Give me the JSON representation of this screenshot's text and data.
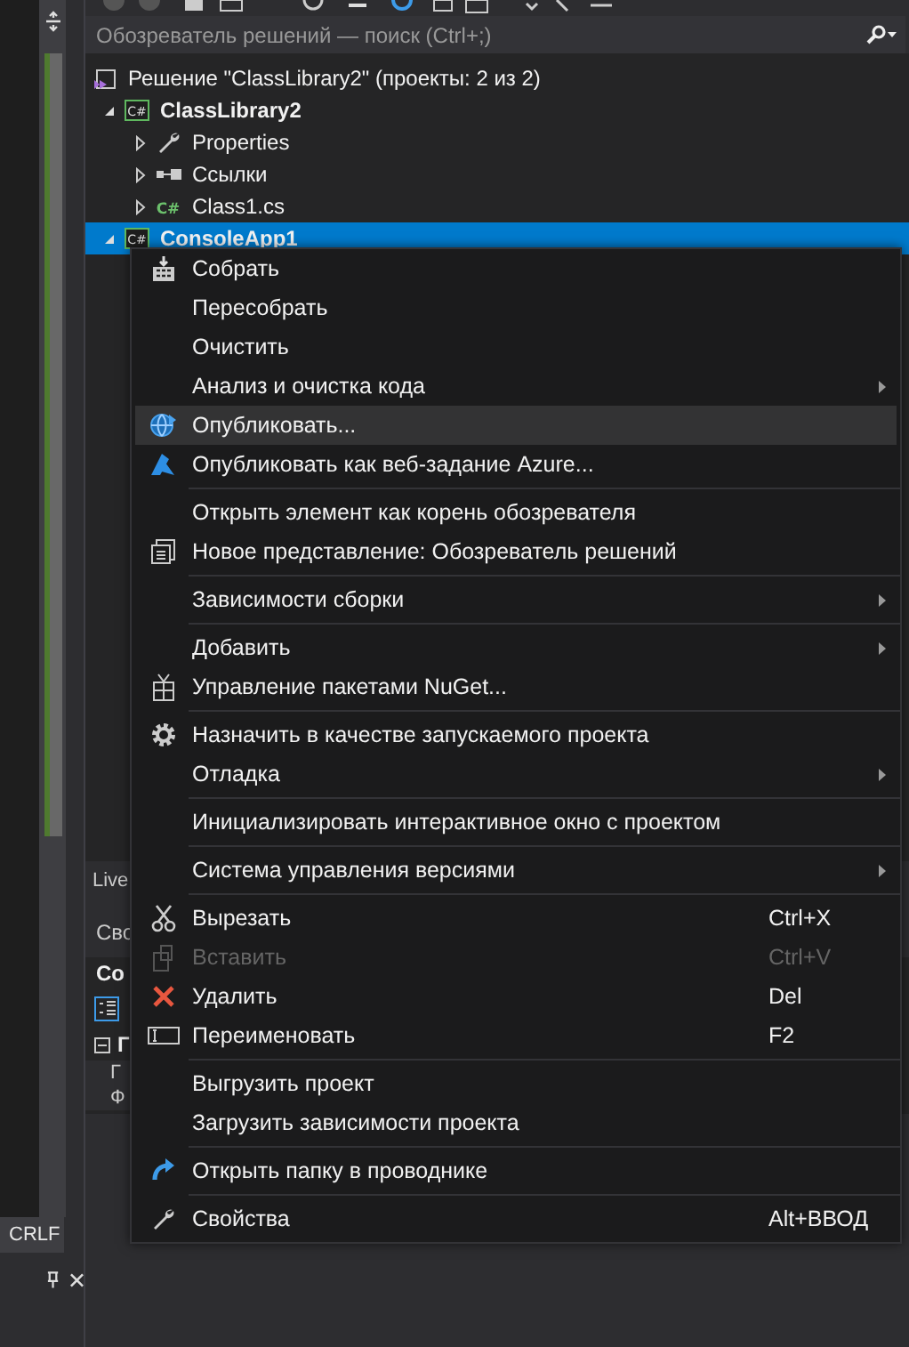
{
  "editor": {
    "status": "CRLF"
  },
  "explorer": {
    "search": {
      "placeholder": "Обозреватель решений — поиск (Ctrl+;)"
    },
    "tree": [
      {
        "kind": "solution",
        "label": "Решение \"ClassLibrary2\" (проекты: 2 из 2)",
        "bold": false,
        "selected": false,
        "children": [
          {
            "kind": "project",
            "badge": "C#",
            "label": "ClassLibrary2",
            "bold": true,
            "expanded": true,
            "selected": false,
            "children": [
              {
                "kind": "properties",
                "label": "Properties",
                "bold": false,
                "expanded": false,
                "selected": false
              },
              {
                "kind": "references",
                "label": "Ссылки",
                "bold": false,
                "expanded": false,
                "selected": false
              },
              {
                "kind": "file",
                "badge": "C#",
                "label": "Class1.cs",
                "bold": false,
                "expanded": false,
                "selected": false
              }
            ]
          },
          {
            "kind": "project",
            "badge": "C#",
            "label": "ConsoleApp1",
            "bold": true,
            "expanded": true,
            "selected": true
          }
        ]
      }
    ],
    "live_tab": "Live",
    "properties": {
      "title": "Сво",
      "object": "Co",
      "group": "Г",
      "rows": [
        "Г",
        "Ф"
      ]
    }
  },
  "context_menu": [
    {
      "kind": "item",
      "label": "Собрать",
      "submenu": false,
      "disabled": false,
      "selected": false
    },
    {
      "kind": "item",
      "label": "Пересобрать",
      "submenu": false,
      "disabled": false,
      "selected": false
    },
    {
      "kind": "item",
      "label": "Очистить",
      "submenu": false,
      "disabled": false,
      "selected": false
    },
    {
      "kind": "item",
      "label": "Анализ и очистка кода",
      "submenu": true,
      "disabled": false,
      "selected": false
    },
    {
      "kind": "item",
      "label": "Опубликовать...",
      "submenu": false,
      "disabled": false,
      "selected": true
    },
    {
      "kind": "item",
      "label": "Опубликовать как веб-задание Azure...",
      "submenu": false,
      "disabled": false,
      "selected": false
    },
    {
      "kind": "separator"
    },
    {
      "kind": "item",
      "label": "Открыть элемент как корень обозревателя",
      "submenu": false,
      "disabled": false,
      "selected": false
    },
    {
      "kind": "item",
      "label": "Новое представление: Обозреватель решений",
      "submenu": false,
      "disabled": false,
      "selected": false
    },
    {
      "kind": "separator"
    },
    {
      "kind": "item",
      "label": "Зависимости сборки",
      "submenu": true,
      "disabled": false,
      "selected": false
    },
    {
      "kind": "separator"
    },
    {
      "kind": "item",
      "label": "Добавить",
      "submenu": true,
      "disabled": false,
      "selected": false
    },
    {
      "kind": "item",
      "label": "Управление пакетами NuGet...",
      "submenu": false,
      "disabled": false,
      "selected": false
    },
    {
      "kind": "separator"
    },
    {
      "kind": "item",
      "label": "Назначить в качестве запускаемого проекта",
      "submenu": false,
      "disabled": false,
      "selected": false
    },
    {
      "kind": "item",
      "label": "Отладка",
      "submenu": true,
      "disabled": false,
      "selected": false
    },
    {
      "kind": "separator"
    },
    {
      "kind": "item",
      "label": "Инициализировать интерактивное окно с проектом",
      "submenu": false,
      "disabled": false,
      "selected": false
    },
    {
      "kind": "separator"
    },
    {
      "kind": "item",
      "label": "Система управления версиями",
      "submenu": true,
      "disabled": false,
      "selected": false
    },
    {
      "kind": "separator"
    },
    {
      "kind": "item",
      "label": "Вырезать",
      "shortcut": "Ctrl+X",
      "submenu": false,
      "disabled": false,
      "selected": false
    },
    {
      "kind": "item",
      "label": "Вставить",
      "shortcut": "Ctrl+V",
      "submenu": false,
      "disabled": true,
      "selected": false
    },
    {
      "kind": "item",
      "label": "Удалить",
      "shortcut": "Del",
      "submenu": false,
      "disabled": false,
      "selected": false
    },
    {
      "kind": "item",
      "label": "Переименовать",
      "shortcut": "F2",
      "submenu": false,
      "disabled": false,
      "selected": false
    },
    {
      "kind": "separator"
    },
    {
      "kind": "item",
      "label": "Выгрузить проект",
      "submenu": false,
      "disabled": false,
      "selected": false
    },
    {
      "kind": "item",
      "label": "Загрузить зависимости проекта",
      "submenu": false,
      "disabled": false,
      "selected": false
    },
    {
      "kind": "separator"
    },
    {
      "kind": "item",
      "label": "Открыть папку в проводнике",
      "submenu": false,
      "disabled": false,
      "selected": false
    },
    {
      "kind": "separator"
    },
    {
      "kind": "item",
      "label": "Свойства",
      "shortcut": "Alt+ВВОД",
      "submenu": false,
      "disabled": false,
      "selected": false
    }
  ]
}
